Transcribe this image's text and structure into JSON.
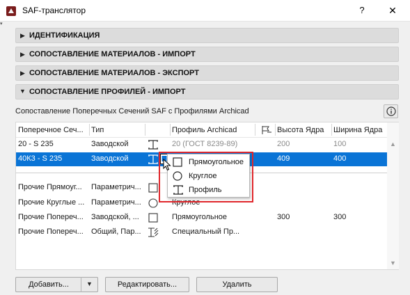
{
  "window": {
    "title": "SAF-транслятор",
    "help": "?",
    "close": "✕"
  },
  "sections": [
    {
      "title": "ИДЕНТИФИКАЦИЯ",
      "expanded": false
    },
    {
      "title": "СОПОСТАВЛЕНИЕ МАТЕРИАЛОВ - ИМПОРТ",
      "expanded": false
    },
    {
      "title": "СОПОСТАВЛЕНИЕ МАТЕРИАЛОВ - ЭКСПОРТ",
      "expanded": false
    },
    {
      "title": "СОПОСТАВЛЕНИЕ ПРОФИЛЕЙ - ИМПОРТ",
      "expanded": true
    }
  ],
  "description": "Сопоставление Поперечных Сечений SAF с Профилями Archicad",
  "table": {
    "headers": {
      "cross_section": "Поперечное Сеч...",
      "type": "Тип",
      "profile": "Профиль Archicad",
      "core_height": "Высота Ядра",
      "core_width": "Ширина Ядра"
    },
    "rows": [
      {
        "cross_section": "20 - S 235",
        "type": "Заводской",
        "shape": "profile",
        "profile": "20 (ГОСТ 8239-89)",
        "core_height": "200",
        "core_width": "100",
        "selected": false,
        "dimmed": true
      },
      {
        "cross_section": "40К3 - S 235",
        "type": "Заводской",
        "shape": "profile",
        "profile": "",
        "core_height": "409",
        "core_width": "400",
        "selected": true,
        "dimmed": false
      },
      {
        "cross_section": "Прочие Прямоуг...",
        "type": "Параметрич...",
        "shape": "rectangle",
        "profile": "",
        "core_height": "",
        "core_width": "",
        "selected": false,
        "dimmed": false
      },
      {
        "cross_section": "Прочие Круглые ...",
        "type": "Параметрич...",
        "shape": "circle",
        "profile": "Круглое",
        "core_height": "",
        "core_width": "",
        "selected": false,
        "dimmed": false
      },
      {
        "cross_section": "Прочие Попереч...",
        "type": "Заводской, ...",
        "shape": "rectangle",
        "profile": "Прямоугольное",
        "core_height": "300",
        "core_width": "300",
        "selected": false,
        "dimmed": false
      },
      {
        "cross_section": "Прочие Попереч...",
        "type": "Общий, Пар...",
        "shape": "special",
        "profile": "Специальный Пр...",
        "core_height": "",
        "core_width": "",
        "selected": false,
        "dimmed": false
      }
    ]
  },
  "shape_menu": {
    "items": [
      {
        "label": "Прямоугольное",
        "icon": "rectangle-icon"
      },
      {
        "label": "Круглое",
        "icon": "circle-icon"
      },
      {
        "label": "Профиль",
        "icon": "i-beam-icon"
      }
    ]
  },
  "buttons": {
    "add": "Добавить...",
    "edit": "Редактировать...",
    "delete": "Удалить"
  },
  "colors": {
    "selection": "#0a74d6",
    "highlight_box": "#e0262b"
  }
}
